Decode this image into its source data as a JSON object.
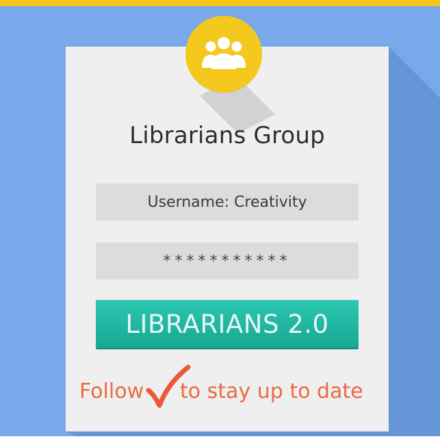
{
  "app": {
    "title": "Librarians Group"
  },
  "login": {
    "username_text": "Username: Creativity",
    "password_mask": "***********",
    "button_label": "LIBRARIANS 2.0"
  },
  "footer": {
    "text_before": "Follow",
    "text_after": "to stay up to date"
  },
  "icons": {
    "badge": "group-icon",
    "check": "checkmark-icon"
  },
  "colors": {
    "background": "#79a8eb",
    "top_stripe": "#f4c416",
    "card": "#efefef",
    "field": "#dcdcdc",
    "badge": "#f5c81d",
    "button": "#17a893",
    "accent_text": "#ea6a43",
    "title_text": "#2e2e2e"
  }
}
